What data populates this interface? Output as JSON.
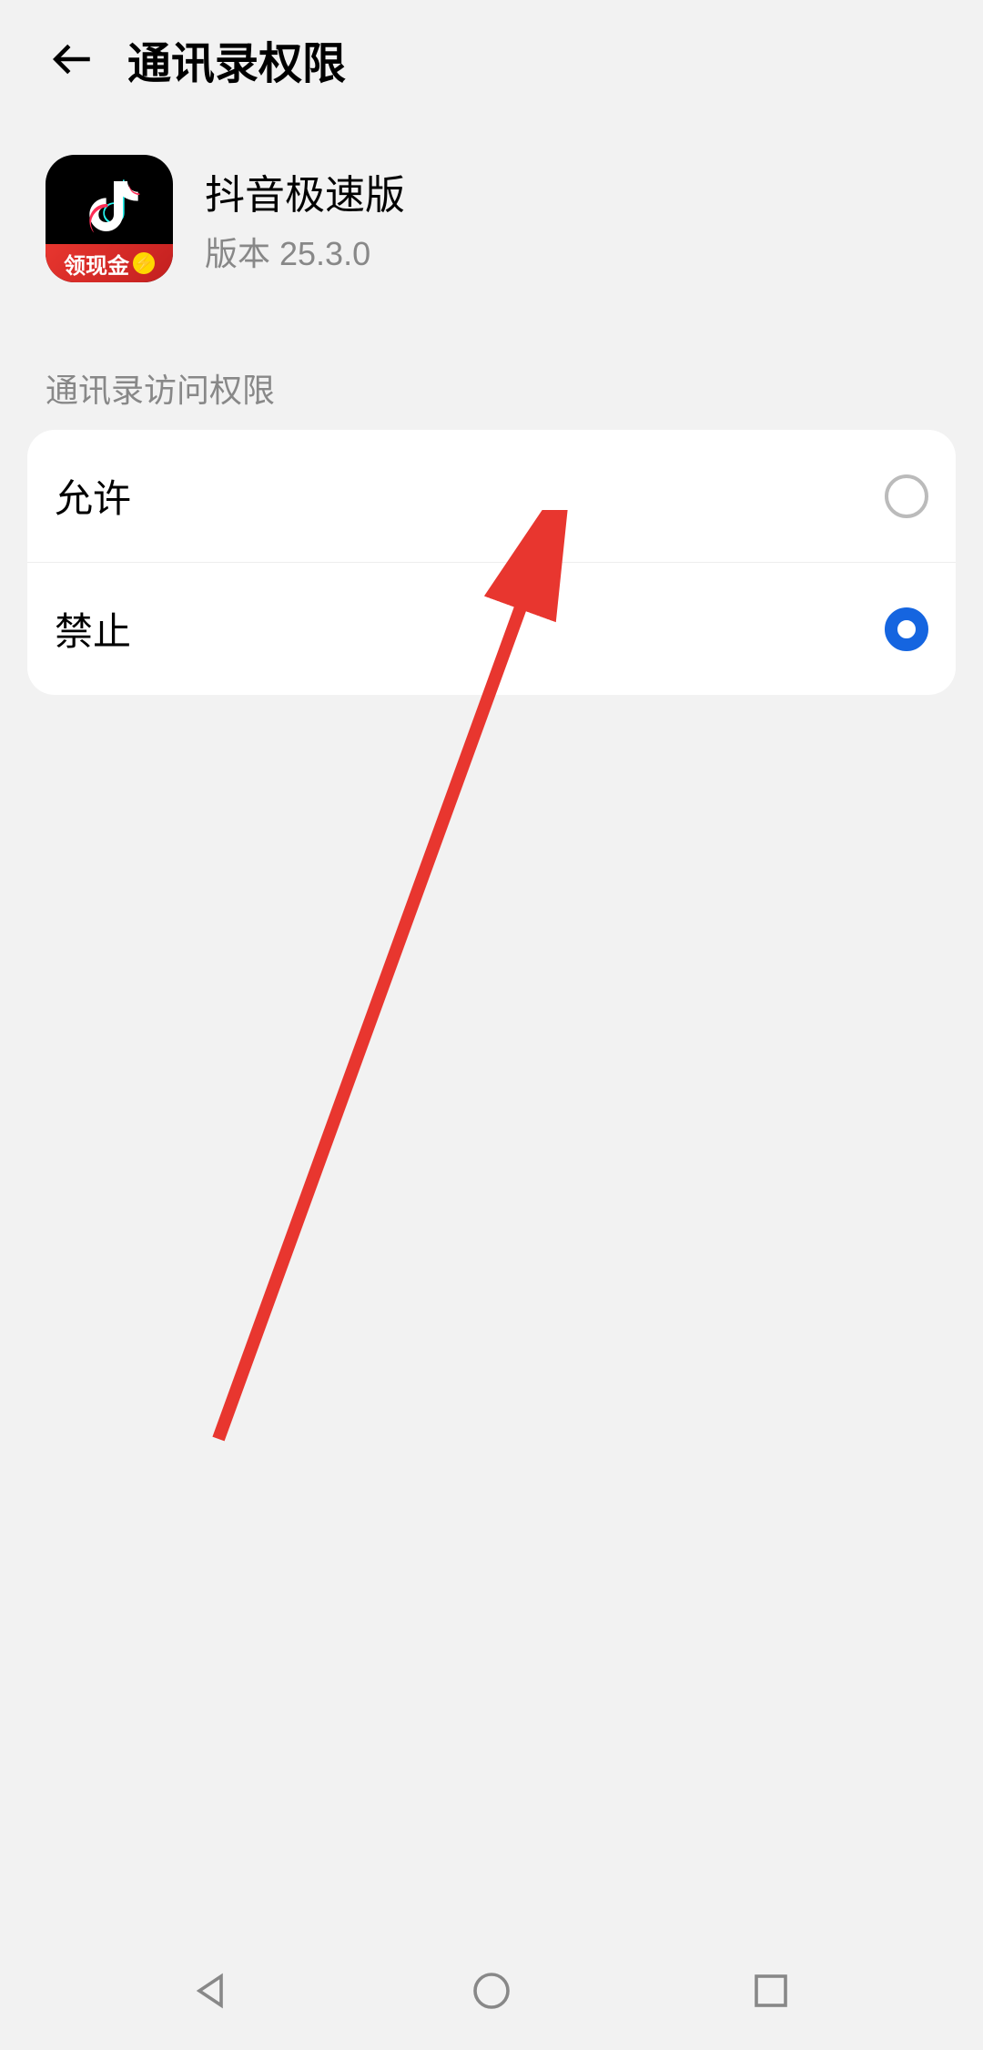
{
  "header": {
    "title": "通讯录权限"
  },
  "app": {
    "name": "抖音极速版",
    "version_label": "版本 25.3.0",
    "banner_text": "领现金"
  },
  "section": {
    "label": "通讯录访问权限"
  },
  "options": {
    "allow": {
      "label": "允许",
      "selected": false
    },
    "deny": {
      "label": "禁止",
      "selected": true
    }
  }
}
